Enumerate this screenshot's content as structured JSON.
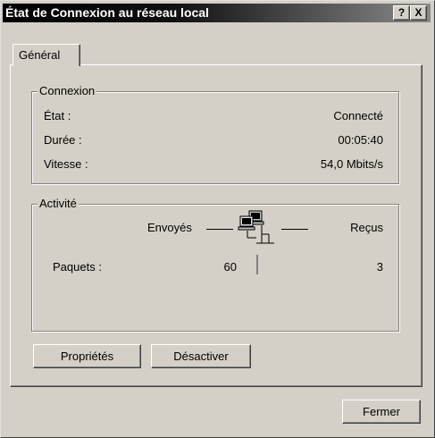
{
  "window": {
    "title": "État de Connexion au réseau local",
    "help_glyph": "?",
    "close_glyph": "X"
  },
  "tabs": [
    {
      "label": "Général"
    }
  ],
  "connexion": {
    "label": "Connexion",
    "rows": [
      {
        "label": "État :",
        "value": "Connecté"
      },
      {
        "label": "Durée :",
        "value": "00:05:40"
      },
      {
        "label": "Vitesse :",
        "value": "54,0 Mbits/s"
      }
    ]
  },
  "activite": {
    "label": "Activité",
    "sent_label": "Envoyés",
    "received_label": "Reçus",
    "packets_label": "Paquets :",
    "packets_sent": "60",
    "packets_received": "3",
    "icon": "network-computers-icon"
  },
  "buttons": {
    "properties": "Propriétés",
    "disable": "Désactiver",
    "close": "Fermer"
  }
}
